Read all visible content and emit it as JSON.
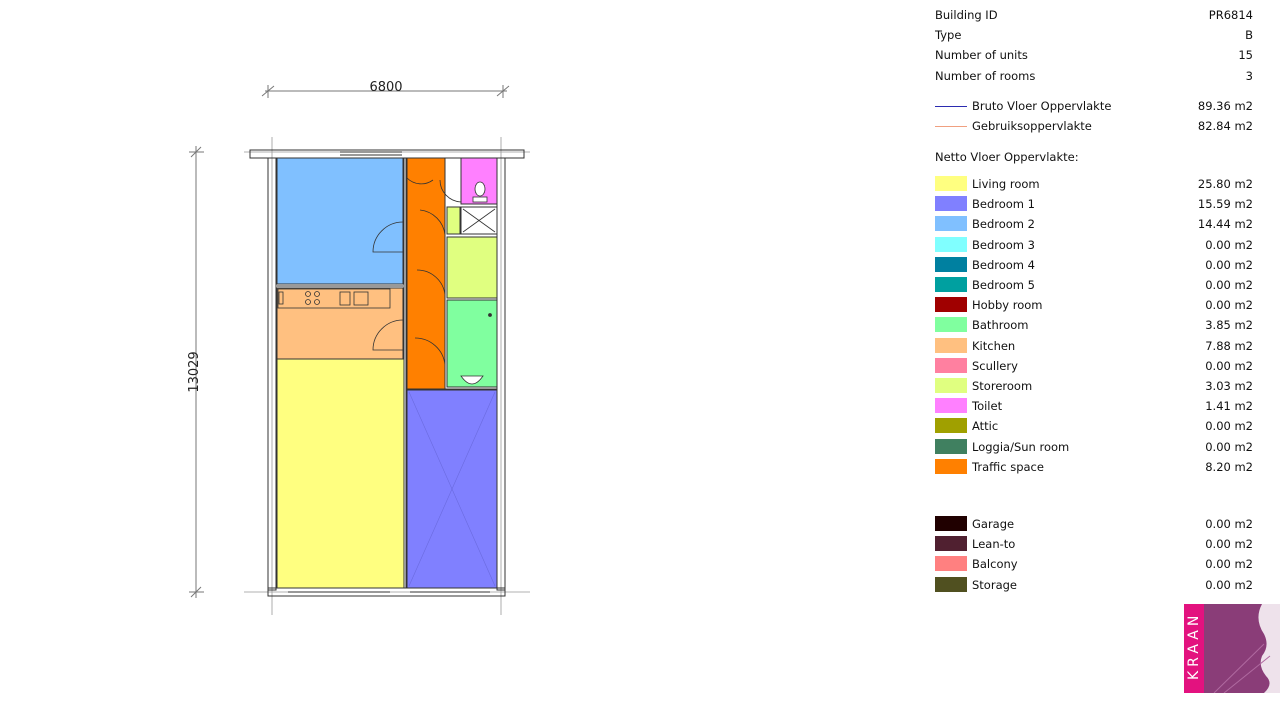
{
  "plan": {
    "width_dim": "6800",
    "height_dim": "13029"
  },
  "info": [
    {
      "label": "Building ID",
      "value": "PR6814"
    },
    {
      "label": "Type",
      "value": "B"
    },
    {
      "label": "Number of units",
      "value": "15"
    },
    {
      "label": "Number of rooms",
      "value": "3"
    }
  ],
  "areas": [
    {
      "label": "Bruto Vloer Oppervlakte",
      "value": "89.36 m2",
      "color": "#2b2bb0"
    },
    {
      "label": "Gebruiksoppervlakte",
      "value": "82.84 m2",
      "color": "#f0a080"
    }
  ],
  "netto_title": "Netto Vloer Oppervlakte:",
  "rooms": [
    {
      "label": "Living room",
      "value": "25.80 m2",
      "color": "#ffff80"
    },
    {
      "label": "Bedroom 1",
      "value": "15.59 m2",
      "color": "#8080ff"
    },
    {
      "label": "Bedroom 2",
      "value": "14.44 m2",
      "color": "#80c0ff"
    },
    {
      "label": "Bedroom 3",
      "value": "0.00 m2",
      "color": "#80ffff"
    },
    {
      "label": "Bedroom 4",
      "value": "0.00 m2",
      "color": "#0080a0"
    },
    {
      "label": "Bedroom 5",
      "value": "0.00 m2",
      "color": "#00a0a0"
    },
    {
      "label": "Hobby room",
      "value": "0.00 m2",
      "color": "#a00000"
    },
    {
      "label": "Bathroom",
      "value": "3.85 m2",
      "color": "#80ff9f"
    },
    {
      "label": "Kitchen",
      "value": "7.88 m2",
      "color": "#ffc080"
    },
    {
      "label": "Scullery",
      "value": "0.00 m2",
      "color": "#ff80a0"
    },
    {
      "label": "Storeroom",
      "value": "3.03 m2",
      "color": "#e0ff80"
    },
    {
      "label": "Toilet",
      "value": "1.41 m2",
      "color": "#ff80ff"
    },
    {
      "label": "Attic",
      "value": "0.00 m2",
      "color": "#a0a000"
    },
    {
      "label": "Loggia/Sun room",
      "value": "0.00 m2",
      "color": "#408060"
    },
    {
      "label": "Traffic space",
      "value": "8.20 m2",
      "color": "#ff8000"
    }
  ],
  "extras": [
    {
      "label": "Garage",
      "value": "0.00 m2",
      "color": "#200000"
    },
    {
      "label": "Lean-to",
      "value": "0.00 m2",
      "color": "#502030"
    },
    {
      "label": "Balcony",
      "value": "0.00 m2",
      "color": "#ff8080"
    },
    {
      "label": "Storage",
      "value": "0.00 m2",
      "color": "#505020"
    }
  ],
  "logo": {
    "text": "KRAAN"
  }
}
